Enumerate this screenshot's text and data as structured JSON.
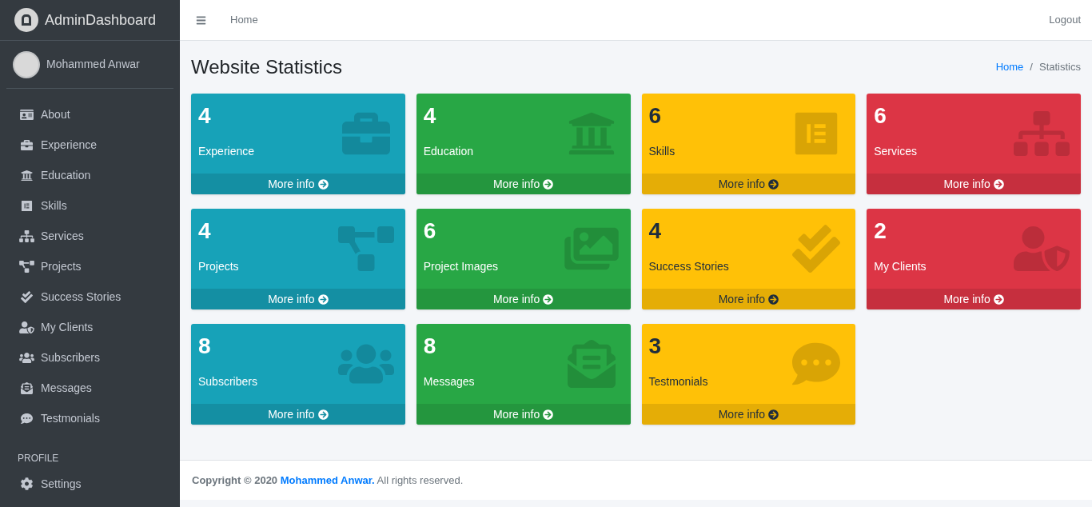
{
  "brand": {
    "title": "AdminDashboard"
  },
  "user": {
    "name": "Mohammed Anwar"
  },
  "sidebar": {
    "items": [
      {
        "label": "About"
      },
      {
        "label": "Experience"
      },
      {
        "label": "Education"
      },
      {
        "label": "Skills"
      },
      {
        "label": "Services"
      },
      {
        "label": "Projects"
      },
      {
        "label": "Success Stories"
      },
      {
        "label": "My Clients"
      },
      {
        "label": "Subscribers"
      },
      {
        "label": "Messages"
      },
      {
        "label": "Testmonials"
      }
    ],
    "section_header": "PROFILE",
    "profile_items": [
      {
        "label": "Settings"
      }
    ]
  },
  "navbar": {
    "links": [
      "Home"
    ],
    "logout": "Logout"
  },
  "page": {
    "title": "Website Statistics",
    "breadcrumb": [
      {
        "label": "Home",
        "link": true
      },
      {
        "label": "Statistics",
        "link": false
      }
    ],
    "breadcrumb_separator": "/"
  },
  "cards": [
    {
      "count": "4",
      "label": "Experience",
      "more": "More info",
      "color": "#17a2b8"
    },
    {
      "count": "4",
      "label": "Education",
      "more": "More info",
      "color": "#28a745"
    },
    {
      "count": "6",
      "label": "Skills",
      "more": "More info",
      "color": "#ffc107"
    },
    {
      "count": "6",
      "label": "Services",
      "more": "More info",
      "color": "#dc3545"
    },
    {
      "count": "4",
      "label": "Projects",
      "more": "More info",
      "color": "#17a2b8"
    },
    {
      "count": "6",
      "label": "Project Images",
      "more": "More info",
      "color": "#28a745"
    },
    {
      "count": "4",
      "label": "Success Stories",
      "more": "More info",
      "color": "#ffc107"
    },
    {
      "count": "2",
      "label": "My Clients",
      "more": "More info",
      "color": "#dc3545"
    },
    {
      "count": "8",
      "label": "Subscribers",
      "more": "More info",
      "color": "#17a2b8"
    },
    {
      "count": "8",
      "label": "Messages",
      "more": "More info",
      "color": "#28a745"
    },
    {
      "count": "3",
      "label": "Testmonials",
      "more": "More info",
      "color": "#ffc107"
    }
  ],
  "footer": {
    "text": "**Copyright © 2020** ",
    "author": "Mohammed Anwar.",
    "rest": " All rights reserved."
  }
}
